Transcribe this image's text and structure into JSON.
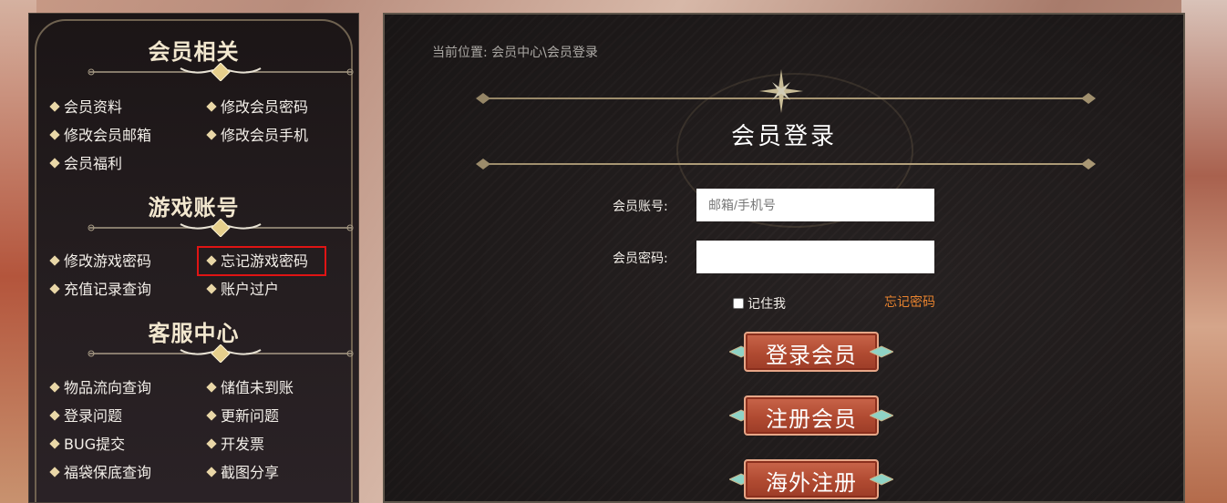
{
  "sidebar": {
    "sections": [
      {
        "title": "会员相关",
        "items": [
          "会员资料",
          "修改会员密码",
          "修改会员邮箱",
          "修改会员手机",
          "会员福利"
        ]
      },
      {
        "title": "游戏账号",
        "items": [
          "修改游戏密码",
          "忘记游戏密码",
          "充值记录查询",
          "账户过户"
        ]
      },
      {
        "title": "客服中心",
        "items": [
          "物品流向查询",
          "储值未到账",
          "登录问题",
          "更新问题",
          "BUG提交",
          "开发票",
          "福袋保底查询",
          "截图分享"
        ]
      }
    ]
  },
  "breadcrumb": {
    "prefix": "当前位置:",
    "crumb1": "会员中心",
    "sep": "\\",
    "crumb2": "会员登录"
  },
  "login": {
    "title": "会员登录",
    "account_label": "会员账号:",
    "account_placeholder": "邮箱/手机号",
    "account_value": "",
    "password_label": "会员密码:",
    "password_value": "",
    "remember_label": "记住我",
    "remember_checked": false,
    "forgot_label": "忘记密码",
    "buttons": {
      "login": "登录会员",
      "register": "注册会员",
      "overseas": "海外注册"
    }
  },
  "colors": {
    "accent_gold": "#e9d7a7",
    "button_red": "#b04a31",
    "forgot_orange": "#e8832f",
    "highlight_red": "#e01414"
  }
}
